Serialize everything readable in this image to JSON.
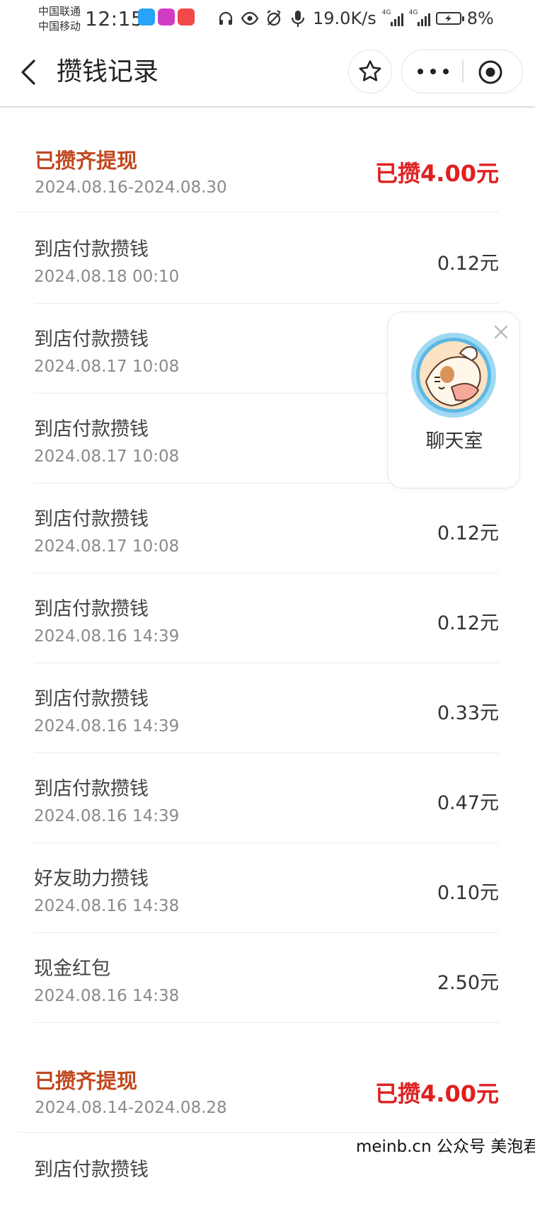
{
  "status_bar": {
    "carrier_1": "中国联通",
    "carrier_2": "中国移动",
    "time": "12:15",
    "net_speed": "19.0K/s",
    "signal_tag_1": "4G",
    "signal_tag_2": "4G",
    "battery": "8%",
    "app_badge_colors": [
      "#27a3f7",
      "#d13cc4",
      "#f24848"
    ]
  },
  "navbar": {
    "title": "攒钱记录"
  },
  "groups": [
    {
      "title": "已攒齐提现",
      "range": "2024.08.16-2024.08.30",
      "amount": "已攒4.00元"
    },
    {
      "title": "已攒齐提现",
      "range": "2024.08.14-2024.08.28",
      "amount": "已攒4.00元"
    }
  ],
  "records": [
    {
      "title": "到店付款攒钱",
      "date": "2024.08.18 00:10",
      "amount": "0.12元"
    },
    {
      "title": "到店付款攒钱",
      "date": "2024.08.17 10:08",
      "amount": ""
    },
    {
      "title": "到店付款攒钱",
      "date": "2024.08.17 10:08",
      "amount": ""
    },
    {
      "title": "到店付款攒钱",
      "date": "2024.08.17 10:08",
      "amount": "0.12元"
    },
    {
      "title": "到店付款攒钱",
      "date": "2024.08.16 14:39",
      "amount": "0.12元"
    },
    {
      "title": "到店付款攒钱",
      "date": "2024.08.16 14:39",
      "amount": "0.33元"
    },
    {
      "title": "到店付款攒钱",
      "date": "2024.08.16 14:39",
      "amount": "0.47元"
    },
    {
      "title": "好友助力攒钱",
      "date": "2024.08.16 14:38",
      "amount": "0.10元"
    },
    {
      "title": "现金红包",
      "date": "2024.08.16 14:38",
      "amount": "2.50元"
    },
    {
      "title": "到店付款攒钱",
      "date": "",
      "amount": ""
    }
  ],
  "chat_widget": {
    "label": "聊天室"
  },
  "watermark": "meinb.cn  公众号 美泡君",
  "colors": {
    "group_title": "#c0491f",
    "group_amount": "#e02020",
    "secondary_text": "#8a8a8a"
  }
}
